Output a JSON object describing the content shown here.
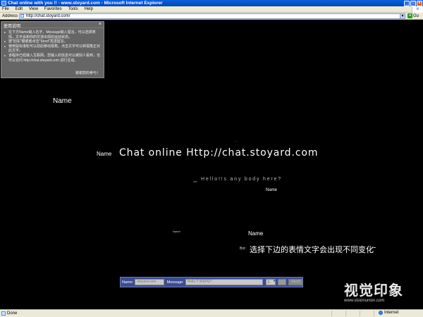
{
  "window": {
    "title": "Chat online with you !! - www.stoyard.com - Microsoft Internet Explorer",
    "buttons": [
      "_",
      "□",
      "×"
    ]
  },
  "menu": {
    "items": [
      "File",
      "Edit",
      "View",
      "Favorites",
      "Tools",
      "Help"
    ],
    "throbber": "e"
  },
  "address": {
    "label": "Address",
    "url": "http://chat.stoyard.com/",
    "go_label": "Go"
  },
  "help_panel": {
    "title": "使用说明",
    "close": "×",
    "items": [
      "在下方Name输入名字，Message输入留言，可以选择表情，文字会和你的交流出现的运动状态。",
      "按\"回车\"键或者点击\"Send\"发送留言。",
      "使用鼠标滚轮可以前后移动视角，点击文字可以转视角正对此文字。",
      "该程序已经接入互联网，您输入的信息可以被别人看到，也可以访问 http://chat.stoyard.com 进行互动。"
    ],
    "thanks": "谢谢您的参与！"
  },
  "scene": {
    "name_large": "Name",
    "name_mid": "Name",
    "chat_big": "Chat online Http://chat.stoyard.com",
    "tiny_dash": "~~",
    "tiny_me": "me",
    "hello": "Hello!!s any body here?",
    "name_small1": "Name",
    "name_tiny": "Name",
    "name_mid2": "Name",
    "bot_label": "Bot:",
    "cn_text": "选择下边的表情文字会出现不同变化",
    "tilde": "~"
  },
  "chatbar": {
    "name_label": "Name:",
    "name_value": "stoyard.com",
    "message_label": "Message:",
    "message_value": "Hello !! 你好吗?",
    "emotion_value": "1",
    "send_label": "Send"
  },
  "watermark": {
    "logo": "视觉印象",
    "url": "www.visionunion.com"
  },
  "status": {
    "left": "Done",
    "zone": "Internet"
  }
}
